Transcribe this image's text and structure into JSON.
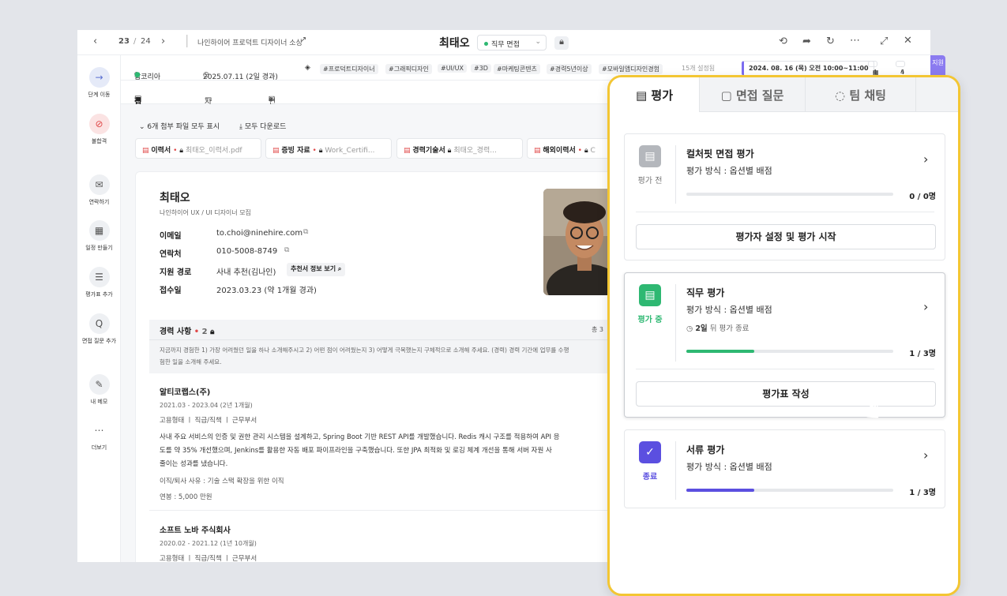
{
  "topbar": {
    "page_current": "23",
    "page_sep": "/",
    "page_total": "24",
    "breadcrumb": "나인하이어 프로덕트 디자이너 소싱",
    "candidate": "최태오",
    "stage": "직무 면접"
  },
  "sidebar": [
    {
      "label": "단계 이동",
      "icon": "arrow-right-icon"
    },
    {
      "label": "불합격",
      "icon": "ban-icon"
    },
    {
      "label": "연락하기",
      "icon": "mail-icon"
    },
    {
      "label": "일정 만들기",
      "icon": "calendar-icon"
    },
    {
      "label": "평가표 추가",
      "icon": "clipboard-icon"
    },
    {
      "label": "면접 질문 추가",
      "icon": "question-icon"
    },
    {
      "label": "내 메모",
      "icon": "memo-icon"
    },
    {
      "label": "더보기",
      "icon": "more-icon"
    }
  ],
  "meta": {
    "source": "잡코리아",
    "date": "2025.07.11 (2일 경과)",
    "tags": [
      "#프로덕트디자이너",
      "#그래픽디자인",
      "#UI/UX",
      "#3D",
      "#마케팅콘텐츠",
      "#경력5년이상",
      "#모바일앱디자인경험"
    ],
    "tag_more": "15개 설정됨",
    "schedule": "2024. 08. 16 (목) 오전 10:00~11:00",
    "count_a": "4",
    "count_b": "4",
    "strip": "지원"
  },
  "tabs": [
    "접수 정보",
    "자료함",
    "연락 내역"
  ],
  "files": {
    "show_all": "6개 첨부 파일 모두 표시",
    "download_all": "모두 다운로드",
    "items": [
      {
        "type": "이력서",
        "name": "최태오_이력서.pdf"
      },
      {
        "type": "증빙 자료",
        "name": "Work_Certifi..."
      },
      {
        "type": "경력기술서",
        "name": "최태오_경력..."
      },
      {
        "type": "해외이력서",
        "name": "C"
      }
    ]
  },
  "profile": {
    "name": "최태오",
    "position": "나인하이어 UX / UI 디자이너 모집",
    "fields": [
      {
        "label": "이메일",
        "value": "to.choi@ninehire.com"
      },
      {
        "label": "연락처",
        "value": "010-5008-8749"
      },
      {
        "label": "지원 경로",
        "value": "사내 추천(김나인)",
        "extra": "추천서 정보 보기"
      },
      {
        "label": "접수일",
        "value": "2023.03.23 (약 1개월 경과)"
      }
    ]
  },
  "career": {
    "title": "경력 사항",
    "count": "2",
    "total": "총 3",
    "prompt": "지금까지 경험한 1) 가장 어려웠던 일을 하나 소개해주시고 2) 어떤 점이 어려웠는지 3) 어떻게 극복했는지 구체적으로 소개해 주세요. (경력) 경력 기간에 업무를 수행",
    "prompt2": "험한 일을 소개해 주세요.",
    "items": [
      {
        "company": "알티코랩스(주)",
        "period": "2021.03 - 2023.04 (2년 1개월)",
        "meta": "고용형태 ㅣ 직급/직책 ㅣ 근무부서",
        "desc1": "사내 주요 서비스의 인증 및 권한 관리 시스템을 설계하고, Spring Boot 기반 REST API를 개발했습니다. Redis 캐시 구조를 적용하여 API 응",
        "desc2": "도를 약 35% 개선했으며, Jenkins를 활용한 자동 배포 파이프라인을 구축했습니다. 또한 JPA 최적화 및 로깅 체계 개선을 통해 서버 자원 사",
        "desc3": "줄이는 성과를 냈습니다.",
        "reason": "이직/퇴사 사유 : 기술 스택 확장을 위한 이직",
        "salary": "연봉 : 5,000 만원"
      },
      {
        "company": "소프트 노바 주식회사",
        "period": "2020.02 - 2021.12 (1년 10개월)",
        "meta": "고용형태 ㅣ 직급/직책 ㅣ 근무부서"
      }
    ]
  },
  "panel": {
    "tabs": [
      "평가",
      "면접 질문",
      "팀 채팅"
    ],
    "evals": [
      {
        "title": "컬처핏 면접 평가",
        "method": "평가 방식 : 옵션별 배점",
        "status": "평가 전",
        "count": "0 / 0명",
        "progress": 0,
        "button": "평가자 설정 및 평가 시작",
        "color": "#b4b7bc"
      },
      {
        "title": "직무 평가",
        "method": "평가 방식 : 옵션별 배점",
        "status": "평가 중",
        "days": "2일",
        "days_suffix": "뒤 평가 종료",
        "count": "1 / 3명",
        "progress": 0.33,
        "button": "평가표 작성",
        "color": "#2eb872"
      },
      {
        "title": "서류 평가",
        "method": "평가 방식 : 옵션별 배점",
        "status": "종료",
        "count": "1 / 3명",
        "progress": 0.33,
        "color": "#5b4fe0"
      }
    ]
  }
}
